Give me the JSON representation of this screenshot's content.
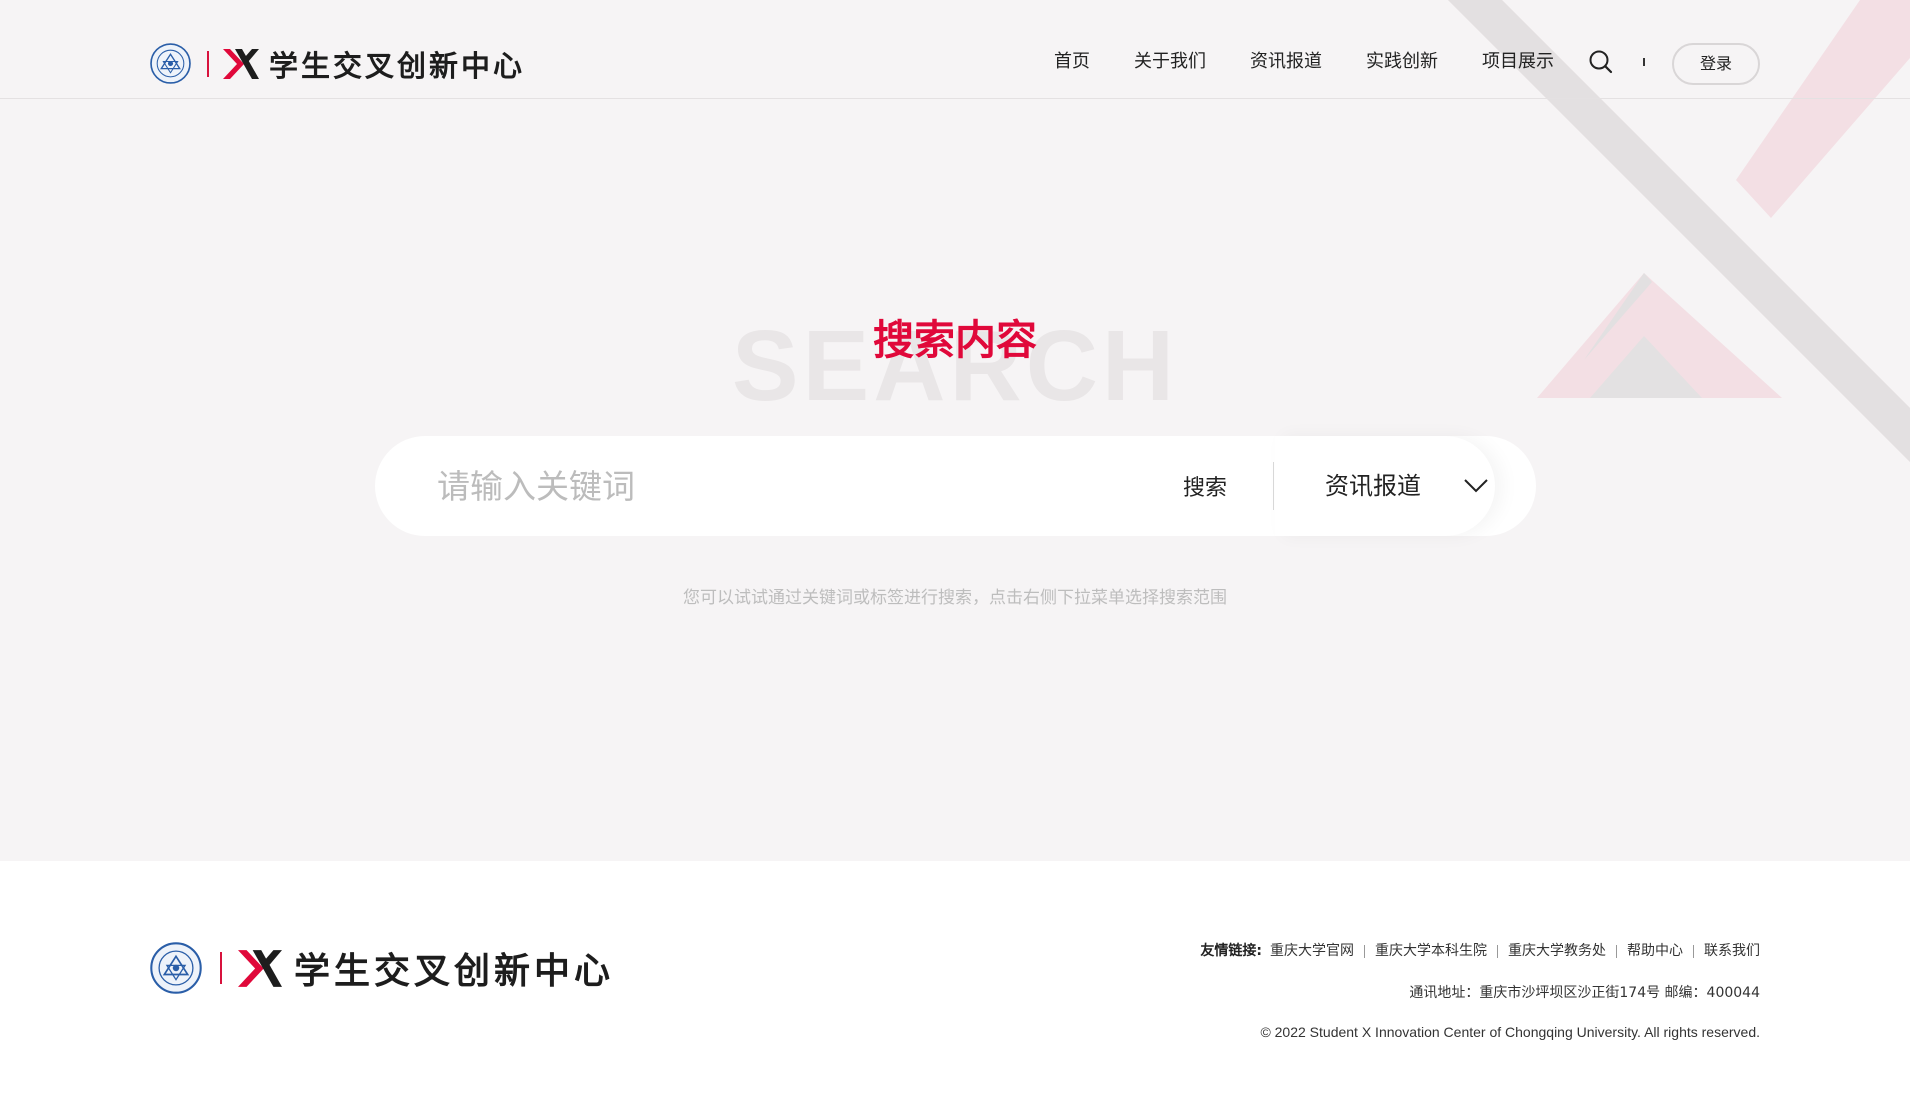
{
  "header": {
    "logo_text": "学生交叉创新中心",
    "nav": [
      "首页",
      "关于我们",
      "资讯报道",
      "实践创新",
      "项目展示"
    ],
    "search_icon": "search-icon",
    "login_label": "登录"
  },
  "search": {
    "bg_word": "SEARCH",
    "title": "搜索内容",
    "placeholder": "请输入关键词",
    "button_label": "搜索",
    "category_value": "资讯报道",
    "dropdown_icon": "chevron-down-icon",
    "hint": "您可以试试通过关键词或标签进行搜索，点击右侧下拉菜单选择搜索范围"
  },
  "footer": {
    "logo_text": "学生交叉创新中心",
    "links_label": "友情链接:",
    "links": [
      "重庆大学官网",
      "重庆大学本科生院",
      "重庆大学教务处",
      "帮助中心",
      "联系我们"
    ],
    "address": "通讯地址：重庆市沙坪坝区沙正街174号 邮编：400044",
    "copyright": "© 2022 Student X Innovation Center of Chongqing University. All rights reserved."
  },
  "colors": {
    "accent": "#e0083a",
    "hero_background": "#f6f4f5",
    "deco_gray": "#e2e0e1",
    "deco_pink": "#f2dde2"
  }
}
